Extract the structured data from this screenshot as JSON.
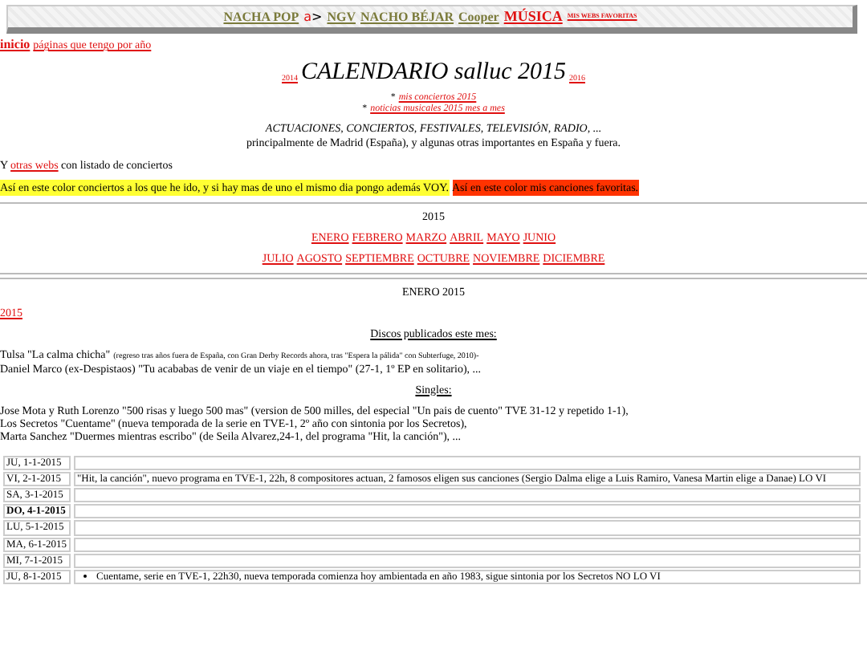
{
  "nav_bar": {
    "items": [
      {
        "label": "NACHA POP",
        "kind": "link",
        "color": "#7a7a3a"
      },
      {
        "label": "a>",
        "kind": "logo",
        "color": "#e01010"
      },
      {
        "label": "NGV",
        "kind": "link",
        "color": "#7a7a3a"
      },
      {
        "label": "NACHO BÉJAR",
        "kind": "link",
        "color": "#7a7a3a"
      },
      {
        "label": "Cooper",
        "kind": "link",
        "color": "#7a7a3a"
      },
      {
        "label": "MÚSICA",
        "kind": "big",
        "color": "#e01010"
      },
      {
        "label": "MIS WEBS FAVORITAS",
        "kind": "small",
        "color": "#e01010"
      }
    ]
  },
  "breadcrumb": {
    "home": "inicio",
    "link": "páginas que tengo por año"
  },
  "header": {
    "prev_year": "2014",
    "title": "CALENDARIO salluc 2015",
    "next_year": "2016",
    "links": [
      {
        "bullet": "*",
        "label": "mis conciertos 2015"
      },
      {
        "bullet": "*",
        "label": "noticias musicales 2015 mes a mes"
      }
    ],
    "subtitle": "ACTUACIONES, CONCIERTOS, FESTIVALES, TELEVISIÓN, RADIO, ...",
    "description": "principalmente de Madrid (España), y algunas otras importantes en España y fuera."
  },
  "other_webs": {
    "before": "Y",
    "link": "otras webs",
    "after": "con listado de conciertos"
  },
  "legend": [
    {
      "text": "Así en este color conciertos a los que he ido, y si hay mas de uno el mismo dia pongo además VOY.",
      "color": "#ffff33"
    },
    {
      "text": "Así en este color mis canciones favoritas.",
      "color": "#ff3300"
    }
  ],
  "months": {
    "year": "2015",
    "first_half": [
      "ENERO",
      "FEBRERO",
      "MARZO",
      "ABRIL",
      "MAYO",
      "JUNIO"
    ],
    "second_half": [
      "JULIO",
      "AGOSTO",
      "SEPTIEMBRE",
      "OCTUBRE",
      "NOVIEMBRE",
      "DICIEMBRE"
    ]
  },
  "month": {
    "title": "ENERO 2015",
    "year_link": "2015",
    "albums_heading": "Discos publicados este mes:",
    "albums": [
      {
        "text": "Tulsa \"La calma chicha\"",
        "note": "(regreso tras años fuera de España, con Gran Derby Records ahora, tras \"Espera la pálida\" con Subterfuge, 2010)-"
      },
      {
        "text": "Daniel Marco (ex-Despistaos) \"Tu acababas de venir de un viaje en el tiempo\" (27-1, 1º EP en solitario), ..."
      }
    ],
    "singles_heading": "Singles:",
    "singles": [
      "Jose Mota y Ruth Lorenzo \"500 risas y luego 500 mas\" (version de 500 milles, del especial \"Un pais de cuento\" TVE 31-12 y repetido 1-1),",
      "Los Secretos \"Cuentame\" (nueva temporada de la serie en TVE-1, 2º año con sintonia por los Secretos),",
      "Marta Sanchez \"Duermes mientras escribo\" (de Seila Alvarez,24-1, del programa \"Hit, la canción\"), ..."
    ]
  },
  "calendar": {
    "rows": [
      {
        "date": "JU, 1-1-2015",
        "sunday": false
      },
      {
        "date": "VI, 2-1-2015",
        "sunday": false,
        "event": "\"Hit, la canción\", nuevo programa en TVE-1, 22h, 8 compositores actuan, 2 famosos eligen sus canciones (Sergio Dalma elige a Luis Ramiro, Vanesa Martin elige a Danae) LO VI"
      },
      {
        "date": "SA, 3-1-2015",
        "sunday": false
      },
      {
        "date": "DO, 4-1-2015",
        "sunday": true
      },
      {
        "date": "LU, 5-1-2015",
        "sunday": false
      },
      {
        "date": "MA, 6-1-2015",
        "sunday": false
      },
      {
        "date": "MI, 7-1-2015",
        "sunday": false
      },
      {
        "date": "JU, 8-1-2015",
        "sunday": false,
        "bullets": [
          "Cuentame, serie en TVE-1, 22h30, nueva temporada comienza hoy ambientada en año 1983, sigue sintonia por los Secretos NO LO VI"
        ]
      }
    ]
  }
}
